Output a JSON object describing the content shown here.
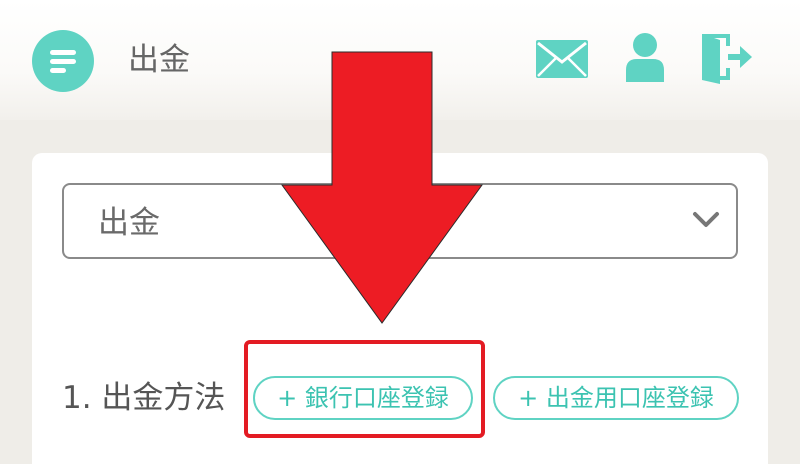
{
  "header": {
    "title": "出金",
    "icons": [
      "menu-icon",
      "mail-icon",
      "user-icon",
      "logout-icon"
    ],
    "accent_color": "#5fd3c3"
  },
  "select": {
    "value": "出金",
    "icon": "chevron-down-icon"
  },
  "method": {
    "label": "1. 出金方法",
    "bank_button": "+ 銀行口座登録",
    "withdraw_button": "+ 出金用口座登録"
  },
  "annotation": {
    "arrow_color": "#ed1c24",
    "highlight_color": "#e31b23"
  }
}
